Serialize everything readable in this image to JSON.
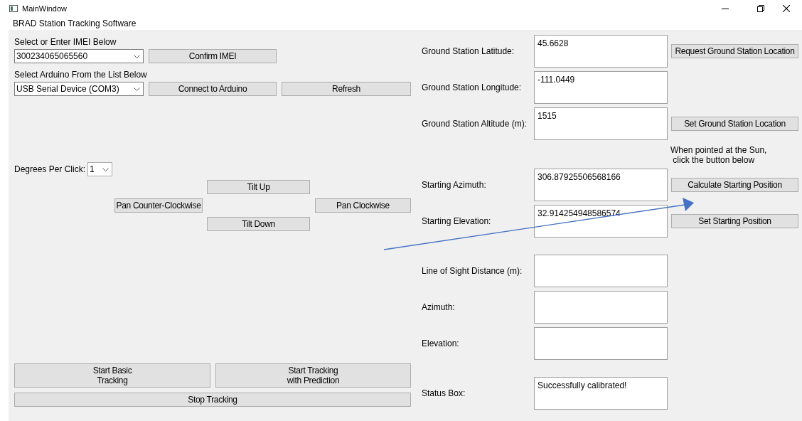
{
  "window": {
    "title": "MainWindow"
  },
  "app_title": "BRAD Station Tracking Software",
  "imei": {
    "label": "Select or Enter IMEI Below",
    "value": "300234065065560",
    "button": "Confirm IMEI"
  },
  "arduino": {
    "label": "Select Arduino From the List Below",
    "value": "USB Serial Device (COM3)",
    "connect_button": "Connect to Arduino",
    "refresh_button": "Refresh"
  },
  "degrees": {
    "label": "Degrees Per Click:",
    "value": "1"
  },
  "motion_buttons": {
    "tilt_up": "Tilt Up",
    "pan_ccw": "Pan Counter-Clockwise",
    "pan_cw": "Pan Clockwise",
    "tilt_down": "Tilt Down"
  },
  "tracking_buttons": {
    "basic": "Start Basic\nTracking",
    "prediction": "Start Tracking\nwith Prediction",
    "stop": "Stop Tracking"
  },
  "location_fields": [
    {
      "label": "Ground Station Latitude:",
      "value": "45.6628",
      "button": "Request Ground Station Location"
    },
    {
      "label": "Ground Station Longitude:",
      "value": "-111.0449"
    },
    {
      "label": "Ground Station Altitude (m):",
      "value": "1515",
      "button": "Set Ground Station Location"
    }
  ],
  "sun_hint": "When pointed at the Sun,\n click the button below",
  "start_fields": [
    {
      "label": "Starting Azimuth:",
      "value": "306.87925506568166",
      "button": "Calculate Starting Position"
    },
    {
      "label": "Starting Elevation:",
      "value": "32.914254948586574",
      "button": "Set Starting Position"
    }
  ],
  "output_fields": [
    {
      "label": "Line of Sight Distance (m):"
    },
    {
      "label": "Azimuth:"
    },
    {
      "label": "Elevation:"
    }
  ],
  "status": {
    "label": "Status Box:",
    "value": "Successfully calibrated!"
  }
}
